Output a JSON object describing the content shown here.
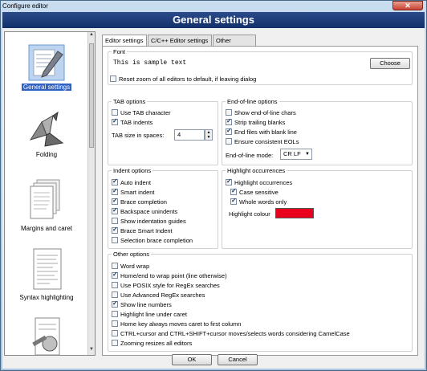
{
  "window": {
    "title": "Configure editor",
    "close_glyph": "✕"
  },
  "header": {
    "title": "General settings"
  },
  "sidebar": {
    "items": [
      {
        "label": "General settings",
        "icon": "pencil-paper-icon",
        "selected": true
      },
      {
        "label": "Folding",
        "icon": "origami-crane-icon"
      },
      {
        "label": "Margins and caret",
        "icon": "pages-icon"
      },
      {
        "label": "Syntax highlighting",
        "icon": "document-icon"
      },
      {
        "label": "",
        "icon": "tools-document-icon"
      }
    ]
  },
  "tabs": [
    {
      "label": "Editor settings",
      "active": true
    },
    {
      "label": "C/C++ Editor settings"
    },
    {
      "label": "Other settings"
    }
  ],
  "font": {
    "title": "Font",
    "sample": "This is sample text",
    "choose_label": "Choose",
    "reset_zoom_label": "Reset zoom of all editors to default, if leaving dialog",
    "reset_zoom_checked": false
  },
  "tab_options": {
    "title": "TAB options",
    "use_tab_label": "Use TAB character",
    "use_tab_checked": false,
    "tab_indents_label": "TAB indents",
    "tab_indents_checked": true,
    "tab_size_label": "TAB size in spaces:",
    "tab_size_value": "4"
  },
  "eol_options": {
    "title": "End-of-line options",
    "items": [
      {
        "label": "Show end-of-line chars",
        "checked": false
      },
      {
        "label": "Strip trailing blanks",
        "checked": true
      },
      {
        "label": "End files with blank line",
        "checked": true
      },
      {
        "label": "Ensure consistent EOLs",
        "checked": false
      }
    ],
    "mode_label": "End-of-line mode:",
    "mode_value": "CR LF"
  },
  "indent_options": {
    "title": "Indent options",
    "items": [
      {
        "label": "Auto indent",
        "checked": true
      },
      {
        "label": "Smart indent",
        "checked": true
      },
      {
        "label": "Brace completion",
        "checked": true
      },
      {
        "label": "Backspace unindents",
        "checked": true
      },
      {
        "label": "Show indentation guides",
        "checked": false
      },
      {
        "label": "Brace Smart Indent",
        "checked": true
      },
      {
        "label": "Selection brace completion",
        "checked": false
      }
    ]
  },
  "highlight": {
    "title": "Highlight occurrences",
    "main_label": "Highlight occurrences",
    "main_checked": true,
    "case_label": "Case sensitive",
    "case_checked": true,
    "whole_label": "Whole words only",
    "whole_checked": true,
    "colour_label": "Highlight colour",
    "colour": "#e8001c"
  },
  "other_options": {
    "title": "Other options",
    "items": [
      {
        "label": "Word wrap",
        "checked": false
      },
      {
        "label": "Home/end to wrap point (line otherwise)",
        "checked": true
      },
      {
        "label": "Use POSIX style for RegEx searches",
        "checked": false
      },
      {
        "label": "Use Advanced RegEx searches",
        "checked": false
      },
      {
        "label": "Show line numbers",
        "checked": true
      },
      {
        "label": "Highlight line under caret",
        "checked": false
      },
      {
        "label": "Home key always moves caret to first column",
        "checked": false
      },
      {
        "label": "CTRL+cursor and CTRL+SHIFT+cursor moves/selects words considering CamelCase",
        "checked": false
      },
      {
        "label": "Zooming resizes all editors",
        "checked": false
      }
    ]
  },
  "footer": {
    "ok_label": "OK",
    "cancel_label": "Cancel"
  }
}
